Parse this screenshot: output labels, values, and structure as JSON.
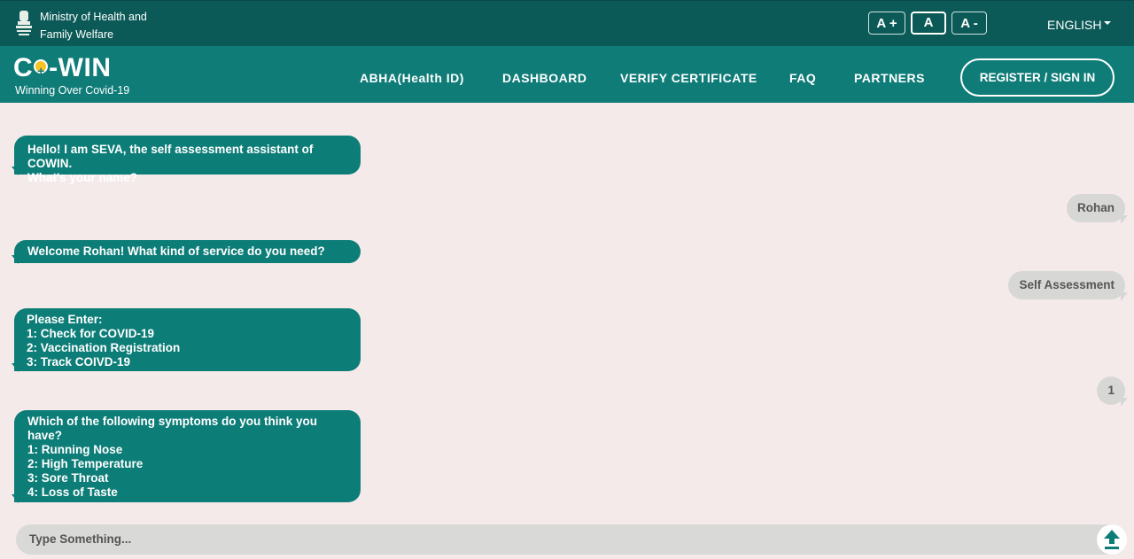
{
  "header": {
    "ministry_line1": "Ministry of Health and",
    "ministry_line2": "Family Welfare",
    "font_increase": "A +",
    "font_normal": "A",
    "font_decrease": "A -",
    "language": "ENGLISH"
  },
  "nav": {
    "logo_left": "C",
    "logo_right": "-WIN",
    "tagline": "Winning Over Covid-19",
    "links": [
      "ABHA(Health ID)",
      "DASHBOARD",
      "VERIFY CERTIFICATE",
      "FAQ",
      "PARTNERS"
    ],
    "register": "REGISTER / SIGN IN"
  },
  "chat": {
    "bot1": [
      "Hello! I am SEVA, the self assessment assistant of COWIN.",
      "What's your name?"
    ],
    "user1": "Rohan",
    "bot2": [
      "Welcome Rohan! What kind of service do you need?"
    ],
    "user2": "Self Assessment",
    "bot3": [
      "Please Enter:",
      "1: Check for COVID-19",
      "2: Vaccination Registration",
      "3: Track COIVD-19"
    ],
    "user3": "1",
    "bot4": [
      "Which of the following symptoms do you think you have?",
      "1: Running Nose",
      "2: High Temperature",
      "3: Sore Throat",
      "4: Loss of Taste"
    ]
  },
  "input": {
    "placeholder": "Type Something..."
  },
  "colors": {
    "topbar": "#0b5a57",
    "navbar": "#0f7c78",
    "bot_bubble": "#0d7d78",
    "user_bubble": "#d7d7d5",
    "background": "#f5eaea"
  }
}
